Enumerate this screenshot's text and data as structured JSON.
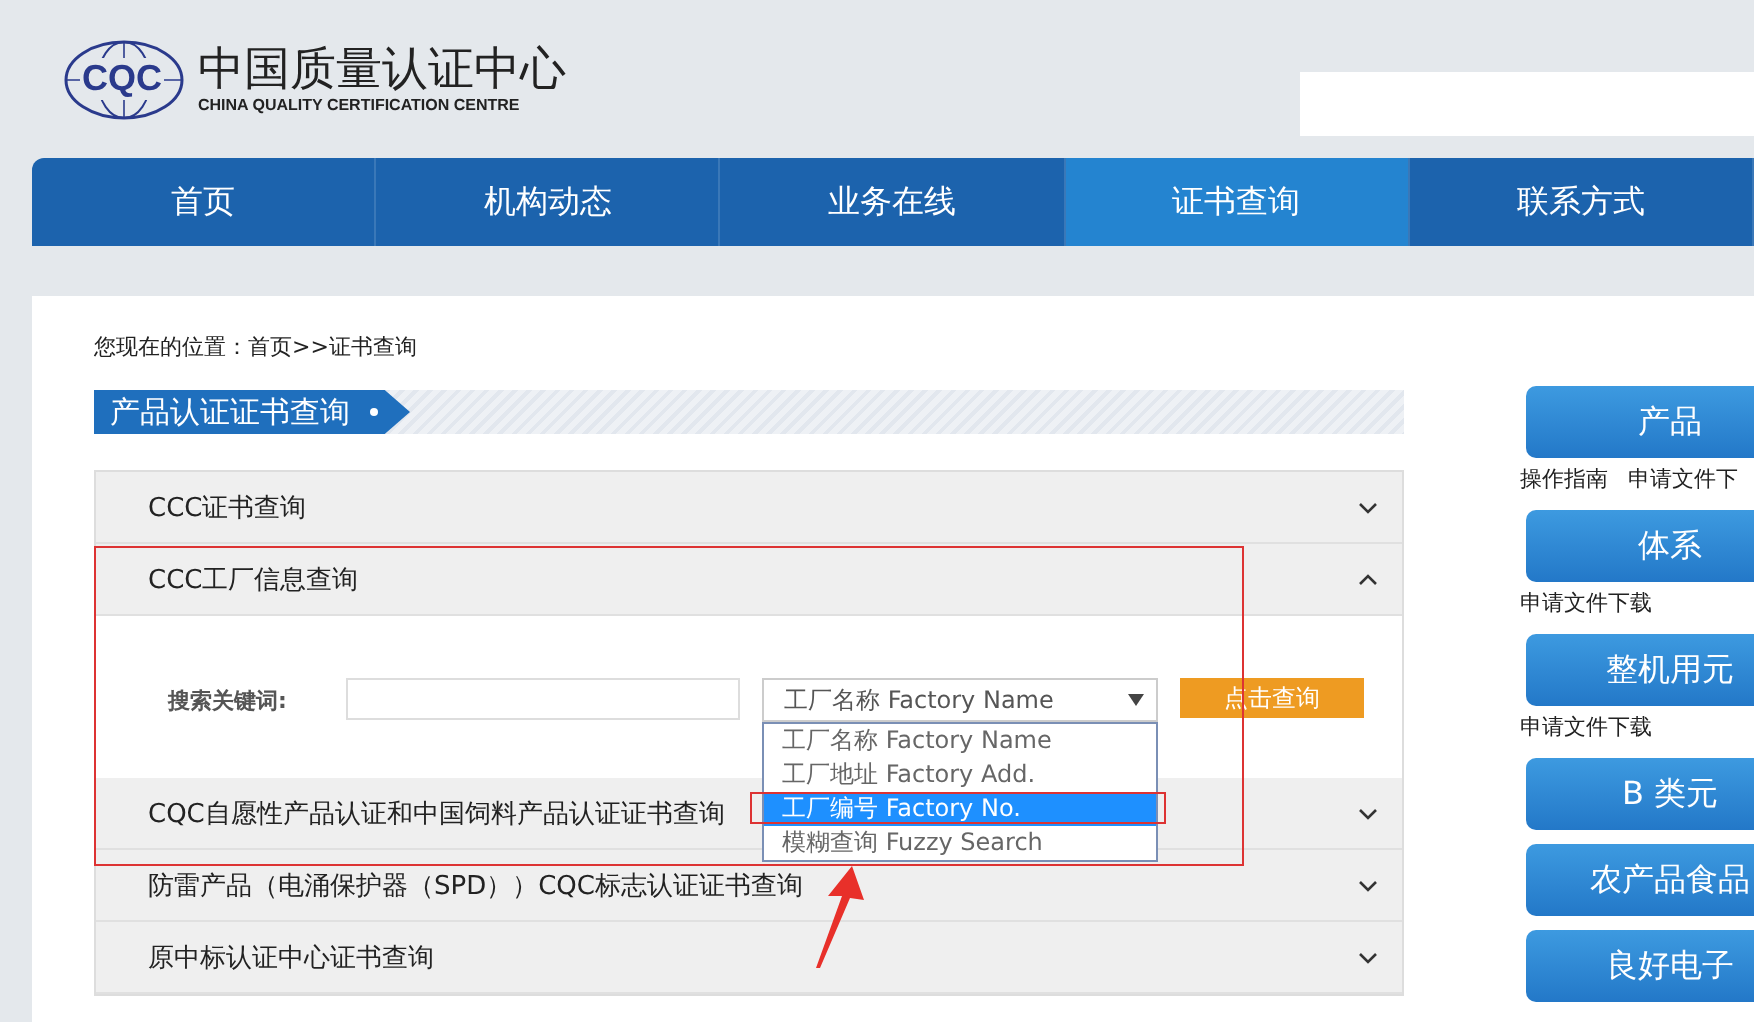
{
  "header": {
    "logo_text": "CQC",
    "title": "中国质量认证中心",
    "subtitle": "CHINA QUALITY CERTIFICATION CENTRE"
  },
  "nav": [
    {
      "label": "首页",
      "selected": false
    },
    {
      "label": "机构动态",
      "selected": false
    },
    {
      "label": "业务在线",
      "selected": false
    },
    {
      "label": "证书查询",
      "selected": true
    },
    {
      "label": "联系方式",
      "selected": false
    }
  ],
  "breadcrumb": "您现在的位置：首页>>证书查询",
  "section_title": "产品认证证书查询",
  "accordion": [
    {
      "label": "CCC证书查询",
      "expanded": false
    },
    {
      "label": "CCC工厂信息查询",
      "expanded": true
    },
    {
      "label": "CQC自愿性产品认证和中国饲料产品认证证书查询",
      "expanded": false
    },
    {
      "label": "防雷产品（电涌保护器（SPD））CQC标志认证证书查询",
      "expanded": false
    },
    {
      "label": "原中标认证中心证书查询",
      "expanded": false
    }
  ],
  "search_form": {
    "label": "搜索关键词:",
    "select_value": "工厂名称 Factory Name",
    "button": "点击查询",
    "options": [
      {
        "label": "工厂名称 Factory Name",
        "selected": false
      },
      {
        "label": "工厂地址 Factory Add.",
        "selected": false
      },
      {
        "label": "工厂编号 Factory No.",
        "selected": true
      },
      {
        "label": "模糊查询 Fuzzy Search",
        "selected": false
      }
    ]
  },
  "sidebar": [
    {
      "button": "产品",
      "links": [
        "操作指南",
        "申请文件下"
      ]
    },
    {
      "button": "体系",
      "links": [
        "申请文件下载"
      ]
    },
    {
      "button": "整机用元",
      "links": [
        "申请文件下载"
      ]
    },
    {
      "button": "B 类元"
    },
    {
      "button": "农产品食品"
    },
    {
      "button": "良好电子"
    }
  ]
}
